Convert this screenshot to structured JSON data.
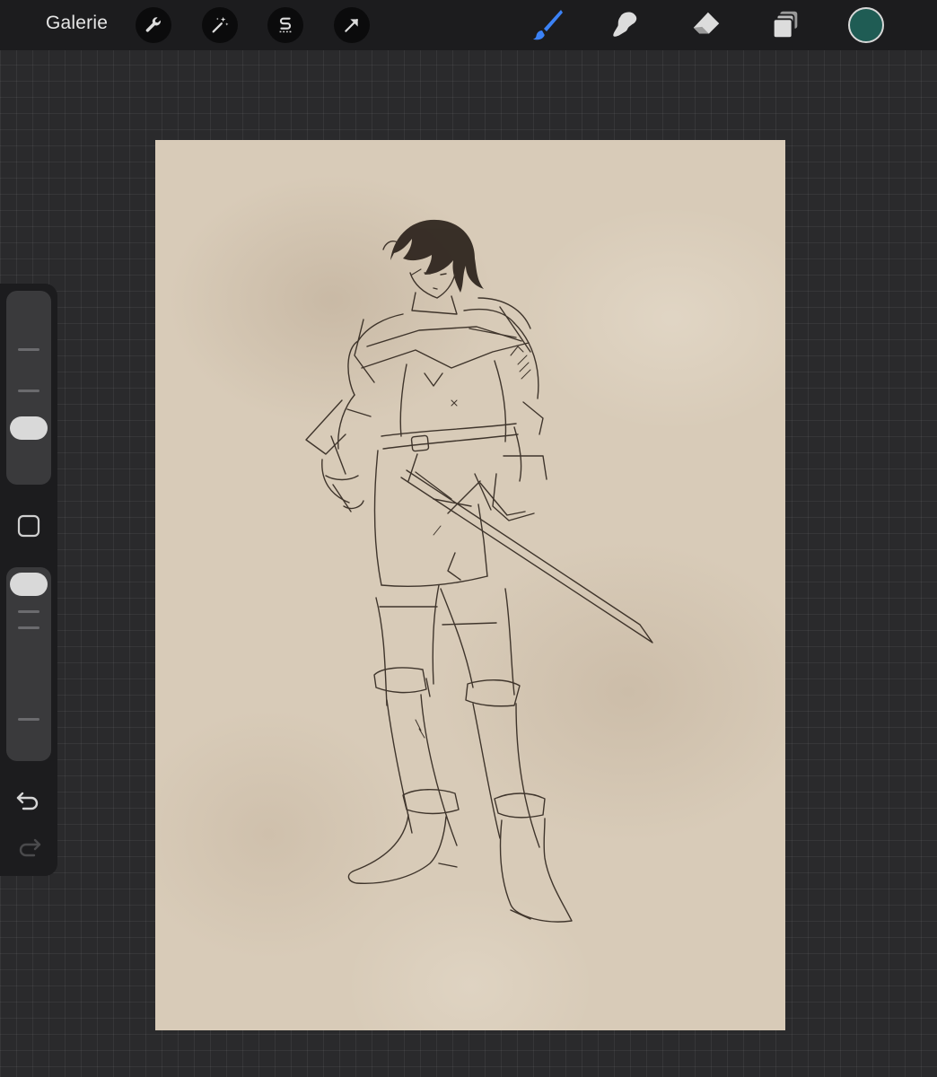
{
  "toolbar": {
    "gallery_label": "Galerie",
    "left_tools": [
      {
        "icon": "wrench-icon",
        "name": "actions"
      },
      {
        "icon": "magic-wand-icon",
        "name": "adjustments"
      },
      {
        "icon": "selection-s-icon",
        "name": "selection"
      },
      {
        "icon": "arrow-cursor-icon",
        "name": "transform"
      }
    ],
    "right_tools": [
      {
        "icon": "brush-icon",
        "name": "brush",
        "active": true
      },
      {
        "icon": "smudge-icon",
        "name": "smudge",
        "active": false
      },
      {
        "icon": "eraser-icon",
        "name": "eraser",
        "active": false
      },
      {
        "icon": "layers-icon",
        "name": "layers",
        "active": false
      }
    ],
    "active_color": "#1f5c54",
    "active_tool_color": "#3b82f6"
  },
  "sidebar": {
    "brush_size_icon": "slider-icon",
    "opacity_icon": "slider-icon",
    "modify_icon": "square-icon",
    "undo_icon": "undo-arrow-icon",
    "redo_icon": "redo-arrow-icon"
  },
  "canvas": {
    "paper_color": "#d8cbb8",
    "ink_color": "#2b2119"
  }
}
